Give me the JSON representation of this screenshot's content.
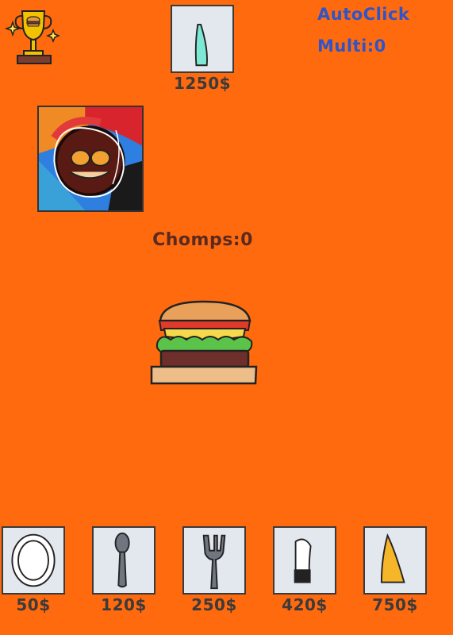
{
  "top_shop": {
    "item": "knife-teal",
    "price": "1250$"
  },
  "stats": {
    "autoclick_label": "AutoClick",
    "multi_label": "Multi:0"
  },
  "chomps_label": "Chomps:0",
  "bottom_shop": [
    {
      "item": "plate",
      "price": "50$"
    },
    {
      "item": "spoon",
      "price": "120$"
    },
    {
      "item": "fork",
      "price": "250$"
    },
    {
      "item": "knife",
      "price": "420$"
    },
    {
      "item": "knife-gold",
      "price": "750$"
    }
  ],
  "colors": {
    "background": "#FF6A0E",
    "stat_text": "#2E55C8",
    "card_bg": "#E3E7EE"
  }
}
